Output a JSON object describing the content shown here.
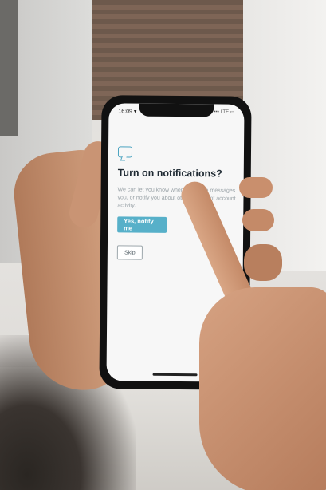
{
  "phone": {
    "status_time": "16:09 ▾",
    "status_right": "▪▪▪ LTE ▭",
    "icon": "message-bubble-icon",
    "title": "Turn on notifications?",
    "body": "We can let you know when someone messages you, or notify you about other important account activity.",
    "primary_button": "Yes, notify me",
    "secondary_button": "Skip",
    "accent_color": "#57b0c9"
  }
}
